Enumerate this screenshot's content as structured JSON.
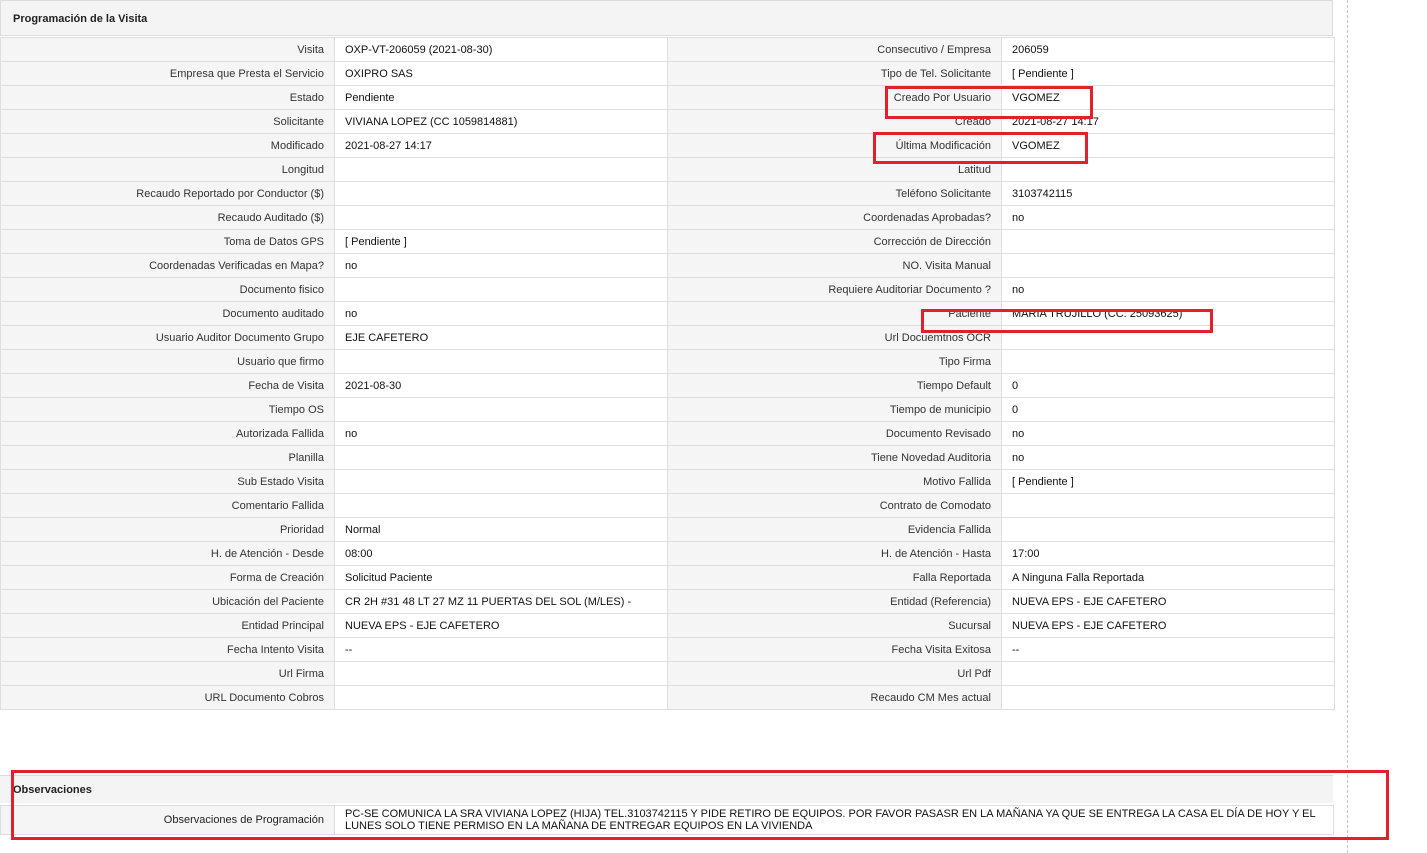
{
  "section_title": "Programación de la Visita",
  "rows": [
    {
      "l1": "Visita",
      "v1": "OXP-VT-206059 (2021-08-30)",
      "l2": "Consecutivo / Empresa",
      "v2": "206059"
    },
    {
      "l1": "Empresa que Presta el Servicio",
      "v1": "OXIPRO SAS",
      "l2": "Tipo de Tel. Solicitante",
      "v2": "[ Pendiente ]"
    },
    {
      "l1": "Estado",
      "v1": "Pendiente",
      "l2": "Creado Por Usuario",
      "v2": "VGOMEZ"
    },
    {
      "l1": "Solicitante",
      "v1": "VIVIANA LOPEZ (CC 1059814881)",
      "l2": "Creado",
      "v2": "2021-08-27 14:17"
    },
    {
      "l1": "Modificado",
      "v1": "2021-08-27 14:17",
      "l2": "Última Modificación",
      "v2": " VGOMEZ"
    },
    {
      "l1": "Longitud",
      "v1": "",
      "l2": "Latitud",
      "v2": ""
    },
    {
      "l1": "Recaudo Reportado por Conductor ($)",
      "v1": "",
      "l2": "Teléfono Solicitante",
      "v2": "3103742115"
    },
    {
      "l1": "Recaudo Auditado ($)",
      "v1": "",
      "l2": "Coordenadas Aprobadas?",
      "v2": " no"
    },
    {
      "l1": "Toma de Datos GPS",
      "v1": "[ Pendiente ]",
      "l2": "Corrección de Dirección",
      "v2": ""
    },
    {
      "l1": "Coordenadas Verificadas en Mapa?",
      "v1": " no",
      "l2": "NO. Visita Manual",
      "v2": ""
    },
    {
      "l1": "Documento fisico",
      "v1": "",
      "l2": "Requiere Auditoriar Documento ?",
      "v2": " no"
    },
    {
      "l1": "Documento auditado",
      "v1": " no",
      "l2": "Paciente",
      "v2": "MARIA TRUJILLO (CC: 25093625)"
    },
    {
      "l1": "Usuario Auditor Documento Grupo",
      "v1": "EJE CAFETERO",
      "l2": "Url Docuemtnos OCR",
      "v2": ""
    },
    {
      "l1": "Usuario que firmo",
      "v1": "",
      "l2": "Tipo Firma",
      "v2": ""
    },
    {
      "l1": "Fecha de Visita",
      "v1": " 2021-08-30",
      "l2": "Tiempo Default",
      "v2": "0"
    },
    {
      "l1": "Tiempo OS",
      "v1": "",
      "l2": "Tiempo de municipio",
      "v2": "0"
    },
    {
      "l1": "Autorizada Fallida",
      "v1": " no",
      "l2": "Documento Revisado",
      "v2": " no"
    },
    {
      "l1": "Planilla",
      "v1": "",
      "l2": "Tiene Novedad Auditoria",
      "v2": " no"
    },
    {
      "l1": "Sub Estado Visita",
      "v1": "",
      "l2": "Motivo Fallida",
      "v2": "[ Pendiente ]"
    },
    {
      "l1": "Comentario Fallida",
      "v1": "",
      "l2": "Contrato de Comodato",
      "v2": ""
    },
    {
      "l1": "Prioridad",
      "v1": "Normal",
      "l2": "Evidencia Fallida",
      "v2": ""
    },
    {
      "l1": "H. de Atención - Desde",
      "v1": "08:00",
      "l2": "H. de Atención - Hasta",
      "v2": "17:00"
    },
    {
      "l1": "Forma de Creación",
      "v1": "Solicitud Paciente",
      "l2": "Falla Reportada",
      "v2": "A Ninguna Falla Reportada"
    },
    {
      "l1": "Ubicación del Paciente",
      "v1": "CR 2H #31 48 LT 27 MZ 11 PUERTAS DEL SOL (M/LES) -",
      "l2": "Entidad (Referencia)",
      "v2": "NUEVA EPS - EJE CAFETERO"
    },
    {
      "l1": "Entidad Principal",
      "v1": "NUEVA EPS - EJE CAFETERO",
      "l2": "Sucursal",
      "v2": "NUEVA EPS - EJE CAFETERO"
    },
    {
      "l1": "Fecha Intento Visita",
      "v1": " --",
      "l2": "Fecha Visita Exitosa",
      "v2": " --"
    },
    {
      "l1": "Url Firma",
      "v1": "",
      "l2": "Url Pdf",
      "v2": ""
    },
    {
      "l1": "URL Documento Cobros",
      "v1": "",
      "l2": "Recaudo CM Mes actual",
      "v2": ""
    }
  ],
  "observaciones": {
    "title": "Observaciones",
    "label": "Observaciones de Programación",
    "value": " PC-SE COMUNICA LA SRA VIVIANA LOPEZ (HIJA) TEL.3103742115 Y PIDE RETIRO DE EQUIPOS. POR FAVOR PASASR EN LA MAÑANA YA QUE SE ENTREGA LA CASA EL DÍA DE HOY Y EL LUNES SOLO TIENE PERMISO EN LA MAÑANA DE ENTREGAR EQUIPOS EN LA VIVIENDA"
  },
  "colors": {
    "highlight": "#e0202a",
    "label_bg": "#f5f5f5",
    "border": "#dedede"
  }
}
